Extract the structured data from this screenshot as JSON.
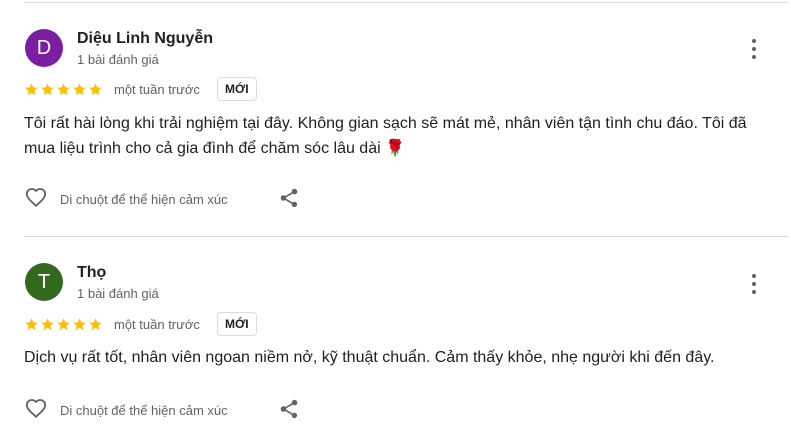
{
  "reviews": [
    {
      "avatar_letter": "D",
      "avatar_color": "#7b1fa2",
      "name": "Diệu Linh Nguyễn",
      "review_count": "1 bài đánh giá",
      "rating": 5,
      "time": "một tuần trước",
      "badge": "MỚI",
      "text": "Tôi rất hài lòng khi trải nghiệm tại đây. Không gian sạch sẽ mát mẻ, nhân viên tận tình chu đáo. Tôi đã mua liệu trình cho cả gia đình để chăm sóc lâu dài 🌹",
      "reaction_label": "Di chuột để thể hiện cảm xúc"
    },
    {
      "avatar_letter": "T",
      "avatar_color": "#33691e",
      "name": "Thọ",
      "review_count": "1 bài đánh giá",
      "rating": 5,
      "time": "một tuần trước",
      "badge": "MỚI",
      "text": "Dịch vụ rất tốt, nhân viên ngoan niềm nở, kỹ thuật chuẩn. Cảm thấy khỏe, nhẹ người khi đến đây.",
      "reaction_label": "Di chuột để thể hiện cảm xúc"
    }
  ],
  "colors": {
    "star": "#fbbc04",
    "icon": "#5f6368"
  }
}
